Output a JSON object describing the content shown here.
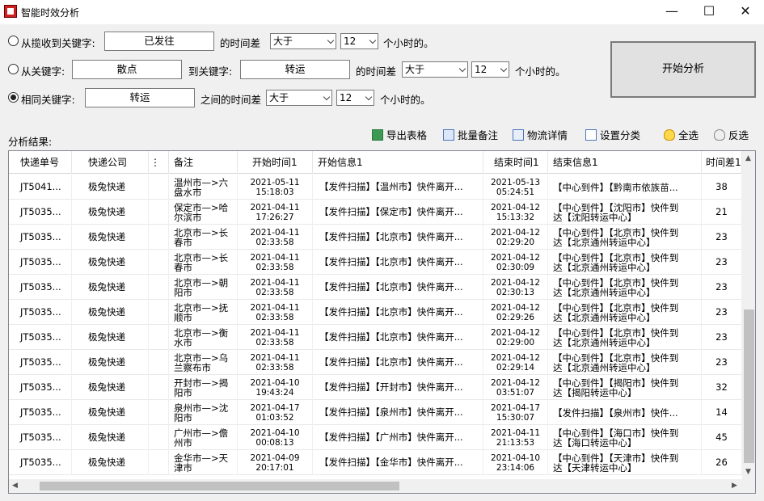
{
  "window": {
    "title": "智能时效分析",
    "min": "—",
    "max": "☐",
    "close": "✕"
  },
  "row1": {
    "label": "从揽收到关键字:",
    "keyword": "已发往",
    "diff_label": "的时间差",
    "compare": "大于",
    "hours": "12",
    "unit": "个小时的。"
  },
  "row2": {
    "label": "从关键字:",
    "keyword": "散点",
    "to_label": "到关键字:",
    "keyword2": "转运",
    "diff_label": "的时间差",
    "compare": "大于",
    "hours": "12",
    "unit": "个小时的。"
  },
  "row3": {
    "label": "相同关键字:",
    "keyword": "转运",
    "diff_label": "之间的时间差",
    "compare": "大于",
    "hours": "12",
    "unit": "个小时的。"
  },
  "start_button": "开始分析",
  "result_label": "分析结果:",
  "toolbar": {
    "export": "导出表格",
    "batch_note": "批量备注",
    "logistics": "物流详情",
    "set_category": "设置分类",
    "select_all": "全选",
    "invert": "反选"
  },
  "columns": [
    "快递单号",
    "快递公司",
    "⋮",
    "备注",
    "开始时间1",
    "开始信息1",
    "结束时间1",
    "结束信息1",
    "时间差1"
  ],
  "rows": [
    {
      "no": "JT5041...",
      "co": "极兔快递",
      "note": [
        "温州市—>六",
        "盘水市"
      ],
      "st": [
        "2021-05-11",
        "15:18:03"
      ],
      "si": "【发件扫描】【温州市】快件离开...",
      "et": [
        "2021-05-13",
        "05:24:51"
      ],
      "ei": [
        "【中心到件】【黔南市依族苗..."
      ],
      "d": "38"
    },
    {
      "no": "JT5035...",
      "co": "极兔快递",
      "note": [
        "保定市—>哈",
        "尔滨市"
      ],
      "st": [
        "2021-04-11",
        "17:26:27"
      ],
      "si": "【发件扫描】【保定市】快件离开...",
      "et": [
        "2021-04-12",
        "15:13:32"
      ],
      "ei": [
        "【中心到件】【沈阳市】快件到",
        "达【沈阳转运中心】"
      ],
      "d": "21"
    },
    {
      "no": "JT5035...",
      "co": "极兔快递",
      "note": [
        "北京市—>长",
        "春市"
      ],
      "st": [
        "2021-04-11",
        "02:33:58"
      ],
      "si": "【发件扫描】【北京市】快件离开...",
      "et": [
        "2021-04-12",
        "02:29:20"
      ],
      "ei": [
        "【中心到件】【北京市】快件到",
        "达【北京通州转运中心】"
      ],
      "d": "23"
    },
    {
      "no": "JT5035...",
      "co": "极兔快递",
      "note": [
        "北京市—>长",
        "春市"
      ],
      "st": [
        "2021-04-11",
        "02:33:58"
      ],
      "si": "【发件扫描】【北京市】快件离开...",
      "et": [
        "2021-04-12",
        "02:30:09"
      ],
      "ei": [
        "【中心到件】【北京市】快件到",
        "达【北京通州转运中心】"
      ],
      "d": "23"
    },
    {
      "no": "JT5035...",
      "co": "极兔快递",
      "note": [
        "北京市—>朝",
        "阳市"
      ],
      "st": [
        "2021-04-11",
        "02:33:58"
      ],
      "si": "【发件扫描】【北京市】快件离开...",
      "et": [
        "2021-04-12",
        "02:30:13"
      ],
      "ei": [
        "【中心到件】【北京市】快件到",
        "达【北京通州转运中心】"
      ],
      "d": "23"
    },
    {
      "no": "JT5035...",
      "co": "极兔快递",
      "note": [
        "北京市—>抚",
        "顺市"
      ],
      "st": [
        "2021-04-11",
        "02:33:58"
      ],
      "si": "【发件扫描】【北京市】快件离开...",
      "et": [
        "2021-04-12",
        "02:29:26"
      ],
      "ei": [
        "【中心到件】【北京市】快件到",
        "达【北京通州转运中心】"
      ],
      "d": "23"
    },
    {
      "no": "JT5035...",
      "co": "极兔快递",
      "note": [
        "北京市—>衡",
        "水市"
      ],
      "st": [
        "2021-04-11",
        "02:33:58"
      ],
      "si": "【发件扫描】【北京市】快件离开...",
      "et": [
        "2021-04-12",
        "02:29:00"
      ],
      "ei": [
        "【中心到件】【北京市】快件到",
        "达【北京通州转运中心】"
      ],
      "d": "23"
    },
    {
      "no": "JT5035...",
      "co": "极兔快递",
      "note": [
        "北京市—>乌",
        "兰察布市"
      ],
      "st": [
        "2021-04-11",
        "02:33:58"
      ],
      "si": "【发件扫描】【北京市】快件离开...",
      "et": [
        "2021-04-12",
        "02:29:14"
      ],
      "ei": [
        "【中心到件】【北京市】快件到",
        "达【北京通州转运中心】"
      ],
      "d": "23"
    },
    {
      "no": "JT5035...",
      "co": "极兔快递",
      "note": [
        "开封市—>揭",
        "阳市"
      ],
      "st": [
        "2021-04-10",
        "19:43:24"
      ],
      "si": "【发件扫描】【开封市】快件离开...",
      "et": [
        "2021-04-12",
        "03:51:07"
      ],
      "ei": [
        "【中心到件】【揭阳市】快件到",
        "达【揭阳转运中心】"
      ],
      "d": "32"
    },
    {
      "no": "JT5035...",
      "co": "极兔快递",
      "note": [
        "泉州市—>沈",
        "阳市"
      ],
      "st": [
        "2021-04-17",
        "01:03:52"
      ],
      "si": "【发件扫描】【泉州市】快件离开...",
      "et": [
        "2021-04-17",
        "15:30:07"
      ],
      "ei": [
        "【发件扫描】【泉州市】快件..."
      ],
      "d": "14"
    },
    {
      "no": "JT5035...",
      "co": "极兔快递",
      "note": [
        "广州市—>儋",
        "州市"
      ],
      "st": [
        "2021-04-10",
        "00:08:13"
      ],
      "si": "【发件扫描】【广州市】快件离开...",
      "et": [
        "2021-04-11",
        "21:13:53"
      ],
      "ei": [
        "【中心到件】【海口市】快件到",
        "达【海口转运中心】"
      ],
      "d": "45"
    },
    {
      "no": "JT5035...",
      "co": "极兔快递",
      "note": [
        "金华市—>天",
        "津市"
      ],
      "st": [
        "2021-04-09",
        "20:17:01"
      ],
      "si": "【发件扫描】【金华市】快件离开...",
      "et": [
        "2021-04-10",
        "23:14:06"
      ],
      "ei": [
        "【中心到件】【天津市】快件到",
        "达【天津转运中心】"
      ],
      "d": "26"
    }
  ]
}
